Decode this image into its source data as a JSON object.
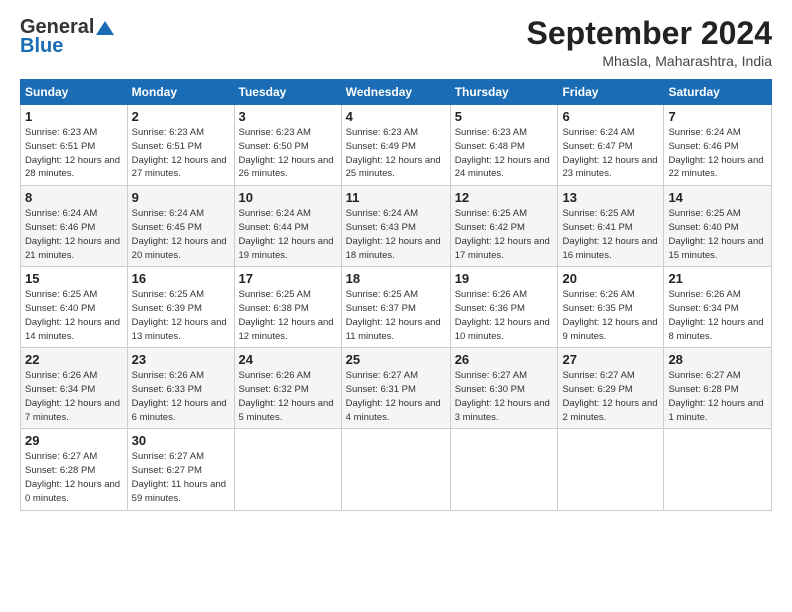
{
  "header": {
    "logo_line1": "General",
    "logo_line2": "Blue",
    "month_title": "September 2024",
    "location": "Mhasla, Maharashtra, India"
  },
  "weekdays": [
    "Sunday",
    "Monday",
    "Tuesday",
    "Wednesday",
    "Thursday",
    "Friday",
    "Saturday"
  ],
  "weeks": [
    [
      {
        "day": "1",
        "sunrise": "6:23 AM",
        "sunset": "6:51 PM",
        "daylight": "12 hours and 28 minutes."
      },
      {
        "day": "2",
        "sunrise": "6:23 AM",
        "sunset": "6:51 PM",
        "daylight": "12 hours and 27 minutes."
      },
      {
        "day": "3",
        "sunrise": "6:23 AM",
        "sunset": "6:50 PM",
        "daylight": "12 hours and 26 minutes."
      },
      {
        "day": "4",
        "sunrise": "6:23 AM",
        "sunset": "6:49 PM",
        "daylight": "12 hours and 25 minutes."
      },
      {
        "day": "5",
        "sunrise": "6:23 AM",
        "sunset": "6:48 PM",
        "daylight": "12 hours and 24 minutes."
      },
      {
        "day": "6",
        "sunrise": "6:24 AM",
        "sunset": "6:47 PM",
        "daylight": "12 hours and 23 minutes."
      },
      {
        "day": "7",
        "sunrise": "6:24 AM",
        "sunset": "6:46 PM",
        "daylight": "12 hours and 22 minutes."
      }
    ],
    [
      {
        "day": "8",
        "sunrise": "6:24 AM",
        "sunset": "6:46 PM",
        "daylight": "12 hours and 21 minutes."
      },
      {
        "day": "9",
        "sunrise": "6:24 AM",
        "sunset": "6:45 PM",
        "daylight": "12 hours and 20 minutes."
      },
      {
        "day": "10",
        "sunrise": "6:24 AM",
        "sunset": "6:44 PM",
        "daylight": "12 hours and 19 minutes."
      },
      {
        "day": "11",
        "sunrise": "6:24 AM",
        "sunset": "6:43 PM",
        "daylight": "12 hours and 18 minutes."
      },
      {
        "day": "12",
        "sunrise": "6:25 AM",
        "sunset": "6:42 PM",
        "daylight": "12 hours and 17 minutes."
      },
      {
        "day": "13",
        "sunrise": "6:25 AM",
        "sunset": "6:41 PM",
        "daylight": "12 hours and 16 minutes."
      },
      {
        "day": "14",
        "sunrise": "6:25 AM",
        "sunset": "6:40 PM",
        "daylight": "12 hours and 15 minutes."
      }
    ],
    [
      {
        "day": "15",
        "sunrise": "6:25 AM",
        "sunset": "6:40 PM",
        "daylight": "12 hours and 14 minutes."
      },
      {
        "day": "16",
        "sunrise": "6:25 AM",
        "sunset": "6:39 PM",
        "daylight": "12 hours and 13 minutes."
      },
      {
        "day": "17",
        "sunrise": "6:25 AM",
        "sunset": "6:38 PM",
        "daylight": "12 hours and 12 minutes."
      },
      {
        "day": "18",
        "sunrise": "6:25 AM",
        "sunset": "6:37 PM",
        "daylight": "12 hours and 11 minutes."
      },
      {
        "day": "19",
        "sunrise": "6:26 AM",
        "sunset": "6:36 PM",
        "daylight": "12 hours and 10 minutes."
      },
      {
        "day": "20",
        "sunrise": "6:26 AM",
        "sunset": "6:35 PM",
        "daylight": "12 hours and 9 minutes."
      },
      {
        "day": "21",
        "sunrise": "6:26 AM",
        "sunset": "6:34 PM",
        "daylight": "12 hours and 8 minutes."
      }
    ],
    [
      {
        "day": "22",
        "sunrise": "6:26 AM",
        "sunset": "6:34 PM",
        "daylight": "12 hours and 7 minutes."
      },
      {
        "day": "23",
        "sunrise": "6:26 AM",
        "sunset": "6:33 PM",
        "daylight": "12 hours and 6 minutes."
      },
      {
        "day": "24",
        "sunrise": "6:26 AM",
        "sunset": "6:32 PM",
        "daylight": "12 hours and 5 minutes."
      },
      {
        "day": "25",
        "sunrise": "6:27 AM",
        "sunset": "6:31 PM",
        "daylight": "12 hours and 4 minutes."
      },
      {
        "day": "26",
        "sunrise": "6:27 AM",
        "sunset": "6:30 PM",
        "daylight": "12 hours and 3 minutes."
      },
      {
        "day": "27",
        "sunrise": "6:27 AM",
        "sunset": "6:29 PM",
        "daylight": "12 hours and 2 minutes."
      },
      {
        "day": "28",
        "sunrise": "6:27 AM",
        "sunset": "6:28 PM",
        "daylight": "12 hours and 1 minute."
      }
    ],
    [
      {
        "day": "29",
        "sunrise": "6:27 AM",
        "sunset": "6:28 PM",
        "daylight": "12 hours and 0 minutes."
      },
      {
        "day": "30",
        "sunrise": "6:27 AM",
        "sunset": "6:27 PM",
        "daylight": "11 hours and 59 minutes."
      },
      null,
      null,
      null,
      null,
      null
    ]
  ]
}
